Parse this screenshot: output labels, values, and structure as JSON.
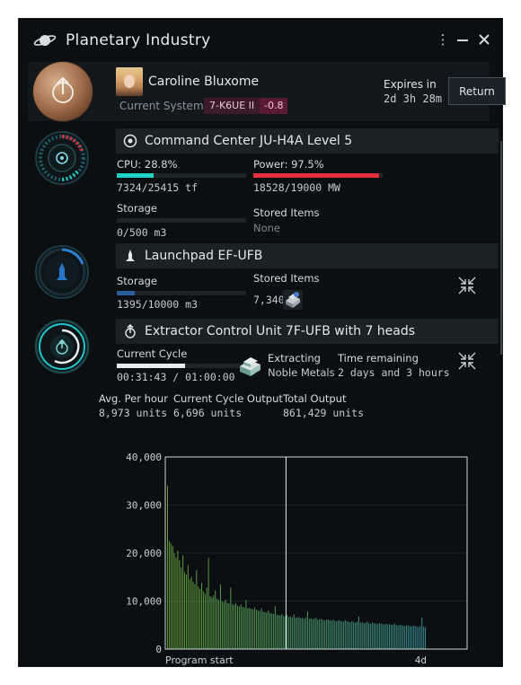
{
  "window": {
    "title": "Planetary Industry",
    "controls": [
      "more-icon",
      "minimize-icon",
      "close-icon"
    ]
  },
  "character": {
    "name": "Caroline Bluxome",
    "current_system_label": "Current System",
    "system": "7-K6UE II",
    "security": "-0.8",
    "expires_label": "Expires in",
    "expires_value": "2d 3h 28m",
    "return_label": "Return"
  },
  "command_center": {
    "title": "Command Center JU-H4A Level 5",
    "cpu_label": "CPU: 28.8%",
    "cpu_fraction": 0.288,
    "cpu_value": "7324/25415 tf",
    "power_label": "Power: 97.5%",
    "power_fraction": 0.975,
    "power_value": "18528/19000 MW",
    "storage_label": "Storage",
    "storage_value": "0/500 m3",
    "storage_fraction": 0.0,
    "stored_items_label": "Stored Items",
    "stored_items_value": "None"
  },
  "launchpad": {
    "title": "Launchpad EF-UFB",
    "storage_label": "Storage",
    "storage_value": "1395/10000 m3",
    "storage_fraction": 0.1395,
    "stored_items_label": "Stored Items",
    "stored_items_value": "7,340 x"
  },
  "extractor": {
    "title": "Extractor Control Unit 7F-UFB with 7 heads",
    "cycle_label": "Current Cycle",
    "cycle_value": "00:31:43 / 01:00:00",
    "cycle_fraction": 0.53,
    "extracting_label": "Extracting",
    "extracting_value": "Noble Metals",
    "time_remaining_label": "Time remaining",
    "time_remaining_value": "2 days and 3 hours",
    "avg_label": "Avg. Per hour",
    "avg_value": "8,973 units",
    "cycle_output_label": "Current Cycle Output",
    "cycle_output_value": "6,696 units",
    "total_output_label": "Total Output",
    "total_output_value": "861,429 units"
  },
  "colors": {
    "cpu": "#22d3c5",
    "power": "#e2303c",
    "storage": "#2a5d9a",
    "cycle": "#e8ecee",
    "chart_bar_start": "#6fb43c",
    "chart_bar_end": "#3fa0a8",
    "chart_frame": "#d0d6d8"
  },
  "chart_data": {
    "type": "bar",
    "ylim": [
      0,
      40000
    ],
    "yticks": [
      "40,000",
      "30,000",
      "20,000",
      "10,000",
      "0"
    ],
    "xticks": [
      "Program start",
      "4d"
    ],
    "current_position_fraction": 0.4,
    "values": [
      34000,
      22500,
      22000,
      21500,
      20000,
      19000,
      20500,
      18500,
      17000,
      19500,
      16000,
      15500,
      17500,
      14500,
      15000,
      14000,
      13500,
      16500,
      13000,
      12500,
      13800,
      12000,
      11500,
      12800,
      19000,
      11000,
      10800,
      11200,
      12200,
      10500,
      10200,
      13500,
      10000,
      9800,
      10300,
      9600,
      9500,
      12800,
      9400,
      9200,
      9600,
      9000,
      8900,
      9300,
      8800,
      8700,
      10200,
      8500,
      8600,
      8400,
      8300,
      8700,
      8200,
      8100,
      7900,
      8500,
      7800,
      7700,
      7600,
      8000,
      7500,
      7400,
      7300,
      9000,
      7200,
      7100,
      7000,
      7300,
      6900,
      6800,
      7100,
      6700,
      6800,
      6600,
      7200,
      6500,
      6600,
      6700,
      6400,
      6500,
      6300,
      6600,
      7800,
      6300,
      6400,
      6200,
      6300,
      6500,
      6100,
      6200,
      6300,
      6100,
      6000,
      6100,
      6200,
      6000,
      5900,
      6100,
      5900,
      5800,
      6000,
      5900,
      5800,
      5700,
      6000,
      5800,
      5700,
      5600,
      5800,
      5600,
      5500,
      5700,
      6800,
      5500,
      5600,
      5400,
      5500,
      5700,
      5400,
      5300,
      5500,
      5400,
      5300,
      5200,
      5400,
      5300,
      5200,
      5100,
      5300,
      5100,
      5200,
      5000,
      5100,
      5300,
      5000,
      4900,
      5100,
      5000,
      4900,
      4800,
      5000,
      4900,
      4800,
      4700,
      4900,
      4800,
      4700,
      4600,
      4800,
      6500,
      4700,
      4600
    ]
  }
}
